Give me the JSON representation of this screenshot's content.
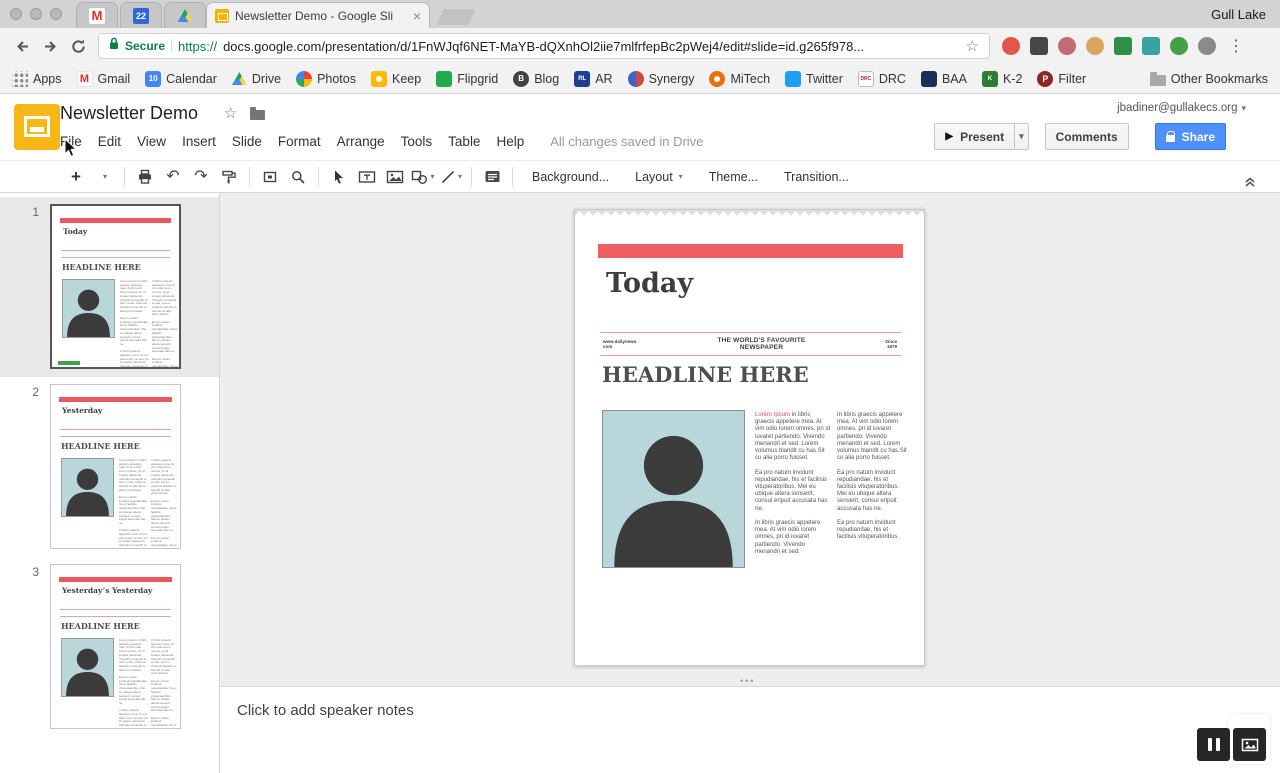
{
  "colors": {
    "accent_red": "#e8585c",
    "photo_blue": "#b9d7da",
    "share_blue": "#4d90fe",
    "secure_green": "#0b8043",
    "slides_yellow": "#f4b400",
    "selection_gray": "#e9e9e9"
  },
  "icons": {
    "plus": "+",
    "close": "×",
    "caret_down": "▾",
    "star_outline": "☆",
    "undo": "↶",
    "redo": "↷",
    "play": "▶",
    "overflow_vertical": "⋮",
    "notes_handle": "•••",
    "gmail_m": "M"
  },
  "browser": {
    "profile": "Gull Lake",
    "tabs": {
      "calendar_badge": "22",
      "active_title": "Newsletter Demo - Google Sli"
    },
    "omnibox": {
      "secure": "Secure",
      "protocol": "https://",
      "url": "docs.google.com/presentation/d/1FnWJqf6NET-MaYB-dQXnhOl2iie7mlfrfepBc2pWej4/edit#slide=id.g265f978..."
    }
  },
  "bookmarks": {
    "items": [
      {
        "label": "Apps"
      },
      {
        "label": "Gmail",
        "icon_text": "M"
      },
      {
        "label": "Calendar",
        "icon_text": "10"
      },
      {
        "label": "Drive"
      },
      {
        "label": "Photos"
      },
      {
        "label": "Keep"
      },
      {
        "label": "Flipgrid"
      },
      {
        "label": "Blog",
        "icon_text": "B"
      },
      {
        "label": "AR",
        "icon_text": "RL"
      },
      {
        "label": "Synergy"
      },
      {
        "label": "MiTech"
      },
      {
        "label": "Twitter"
      },
      {
        "label": "DRC",
        "icon_text": "DRC"
      },
      {
        "label": "BAA"
      },
      {
        "label": "K-2",
        "icon_text": "K"
      },
      {
        "label": "Filter",
        "icon_text": "P"
      }
    ],
    "other_label": "Other Bookmarks"
  },
  "app": {
    "doc_title": "Newsletter Demo",
    "account_email": "jbadiner@gullakecs.org",
    "menus": [
      "File",
      "Edit",
      "View",
      "Insert",
      "Slide",
      "Format",
      "Arrange",
      "Tools",
      "Table",
      "Help"
    ],
    "save_status": "All changes saved in Drive",
    "present_label": "Present",
    "comments_label": "Comments",
    "share_label": "Share",
    "toolbar": {
      "background_label": "Background...",
      "layout_label": "Layout",
      "theme_label": "Theme...",
      "transition_label": "Transition..."
    }
  },
  "filmstrip": {
    "slides": [
      {
        "number": "1",
        "title": "Today"
      },
      {
        "number": "2",
        "title": "Yesterday"
      },
      {
        "number": "3",
        "title": "Yesterday’s Yesterday"
      }
    ]
  },
  "slide": {
    "title": "Today",
    "masthead": {
      "left": "www.dailynews.\ncom",
      "center": "THE WORLD'S FAVOURITE\nNEWSPAPER",
      "right": "- Since\n1879"
    },
    "headline": "HEADLINE HERE",
    "columns": {
      "col1_lead": "Lorem Ipsum",
      "col1_rest": " in libris graecis appetere mea. At vim odio lorem omnes, pri id iuvaret partiendo. Vivendo menandri et sed. Lorem volumus blandit cu has.Sit cu alia porro fuisset.\n\nEa pro natum invidunt repudiandae, his et facilisis vituperatoribus. Mei eu ubique altera senserit, consul eripuit accusata has ne.\n\nIn libris graecis appetere mea. At vim odio lorem omnes, pri id iuvaret partiendo. Vivendo menandri et sed.",
      "col2": "In libris graecis appetere mea. At vim odio lorem omnes, pri id iuvaret partiendo. Vivendo menandri et sed. Lorem volumus blandit cu has.Sit cu alia porro fuisset.\n\nEa pro natum invidunt repudiandae, his et facilisis vituperatoribus. Mei eu ubique altera senserit, consul eripuit accusata has ne.\n\nEa pro natum invidunt repudiandae, his et facilisis vituperatoribus."
    }
  },
  "notes": {
    "placeholder": "Click to add speaker notes"
  }
}
